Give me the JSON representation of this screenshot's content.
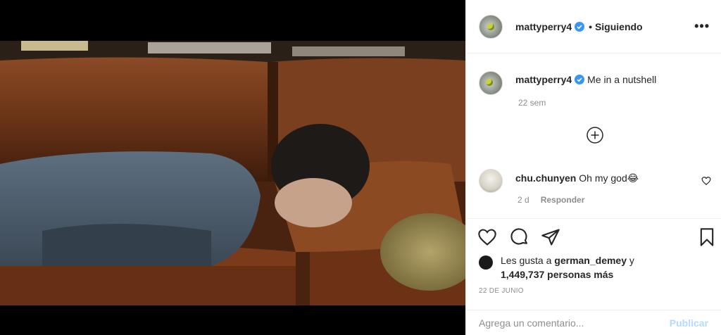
{
  "post": {
    "author": "mattyperry4",
    "follow_status": "• Siguiendo",
    "more_icon": "•••",
    "caption_author": "mattyperry4",
    "caption_text": "Me in a nutshell",
    "caption_time": "22 sem",
    "load_more_icon": "plus-circle-icon"
  },
  "comment": {
    "author": "chu.chunyen",
    "text": "Oh my god😂",
    "time": "2 d",
    "reply_label": "Responder"
  },
  "likes": {
    "prefix": "Les gusta a ",
    "user": "german_demey",
    "conj": " y",
    "count": "1,449,737 personas más"
  },
  "date": "22 DE JUNIO",
  "composer": {
    "placeholder": "Agrega un comentario...",
    "publish_label": "Publicar"
  },
  "colors": {
    "verified": "#3897f0",
    "publish_disabled": "#b3dbff",
    "muted": "#8e8e8e"
  }
}
